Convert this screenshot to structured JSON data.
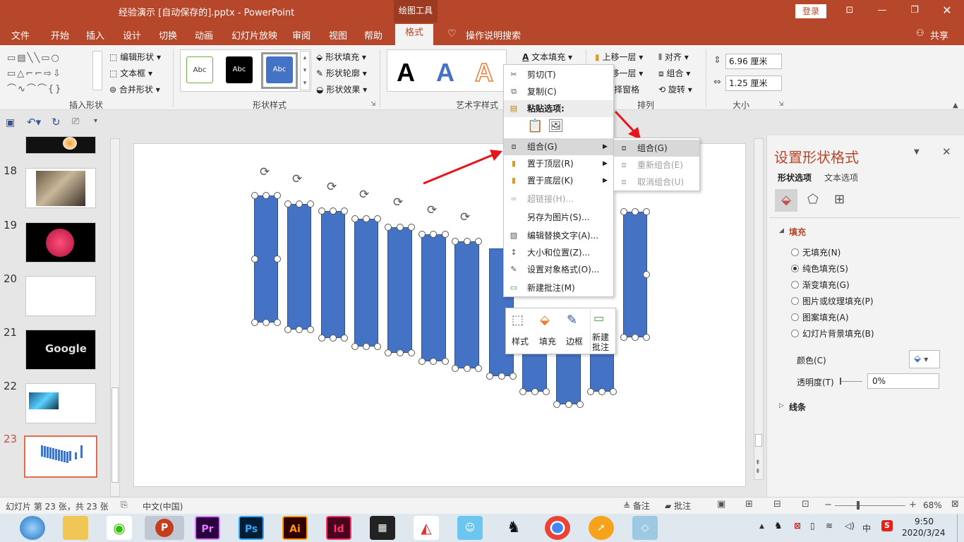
{
  "titlebar": {
    "document_title": "经验演示 [自动保存的].pptx  -  PowerPoint",
    "context_tab_group": "绘图工具",
    "login_label": "登录"
  },
  "menu": {
    "tabs": [
      "文件",
      "开始",
      "插入",
      "设计",
      "切换",
      "动画",
      "幻灯片放映",
      "审阅",
      "视图",
      "帮助",
      "格式"
    ],
    "search_label": "操作说明搜索",
    "share_label": "共享"
  },
  "ribbon": {
    "insert_shapes": {
      "edit_shape": "编辑形状",
      "text_box": "文本框",
      "merge_shapes": "合并形状",
      "label": "插入形状"
    },
    "shape_styles": {
      "preview_text": "Abc",
      "shape_fill": "形状填充",
      "shape_outline": "形状轮廓",
      "shape_effects": "形状效果",
      "label": "形状样式"
    },
    "wordart": {
      "letter": "A",
      "text_fill": "文本填充",
      "label": "艺术字样式"
    },
    "arrange": {
      "bring_forward": "上移一层",
      "send_backward": "下移一层",
      "selection_pane": "选择窗格",
      "align": "对齐",
      "group": "组合",
      "rotate": "旋转",
      "label": "排列"
    },
    "size": {
      "height": "6.96 厘米",
      "width": "1.25 厘米",
      "label": "大小"
    }
  },
  "thumbnails": {
    "numbers": [
      "18",
      "19",
      "20",
      "21",
      "22",
      "23"
    ],
    "google_text": "Google"
  },
  "context_menu": {
    "cut": "剪切(T)",
    "copy": "复制(C)",
    "paste_options": "粘贴选项:",
    "group": "组合(G)",
    "bring_to_front": "置于顶层(R)",
    "send_to_back": "置于底层(K)",
    "hyperlink": "超链接(H)...",
    "save_as_picture": "另存为图片(S)...",
    "edit_alt_text": "编辑替换文字(A)...",
    "size_position": "大小和位置(Z)...",
    "format_object": "设置对象格式(O)...",
    "new_comment": "新建批注(M)"
  },
  "submenu": {
    "group": "组合(G)",
    "regroup": "重新组合(E)",
    "ungroup": "取消组合(U)"
  },
  "minibar": {
    "style": "样式",
    "fill": "填充",
    "outline": "边框",
    "new_comment_line1": "新建",
    "new_comment_line2": "批注"
  },
  "format_pane": {
    "title": "设置形状格式",
    "tab_shape": "形状选项",
    "tab_text": "文本选项",
    "fill_section": "填充",
    "options": [
      "无填充(N)",
      "纯色填充(S)",
      "渐变填充(G)",
      "图片或纹理填充(P)",
      "图案填充(A)",
      "幻灯片背景填充(B)"
    ],
    "selected_option": "纯色填充(S)",
    "color_label": "颜色(C)",
    "transparency_label": "透明度(T)",
    "transparency_value": "0%",
    "line_section": "线条"
  },
  "statusbar": {
    "slide_info": "幻灯片 第 23 张，共 23 张",
    "language": "中文(中国)",
    "notes": "备注",
    "comments": "批注",
    "zoom": "68%"
  },
  "taskbar": {
    "apps": [
      "Pr",
      "Ps",
      "Ai",
      "Id"
    ],
    "time": "9:50",
    "date": "2020/3/24",
    "ime": "中"
  },
  "colors": {
    "accent": "#b7472a",
    "bar_fill": "#4472c4",
    "selection_border": "#e46c4a"
  }
}
